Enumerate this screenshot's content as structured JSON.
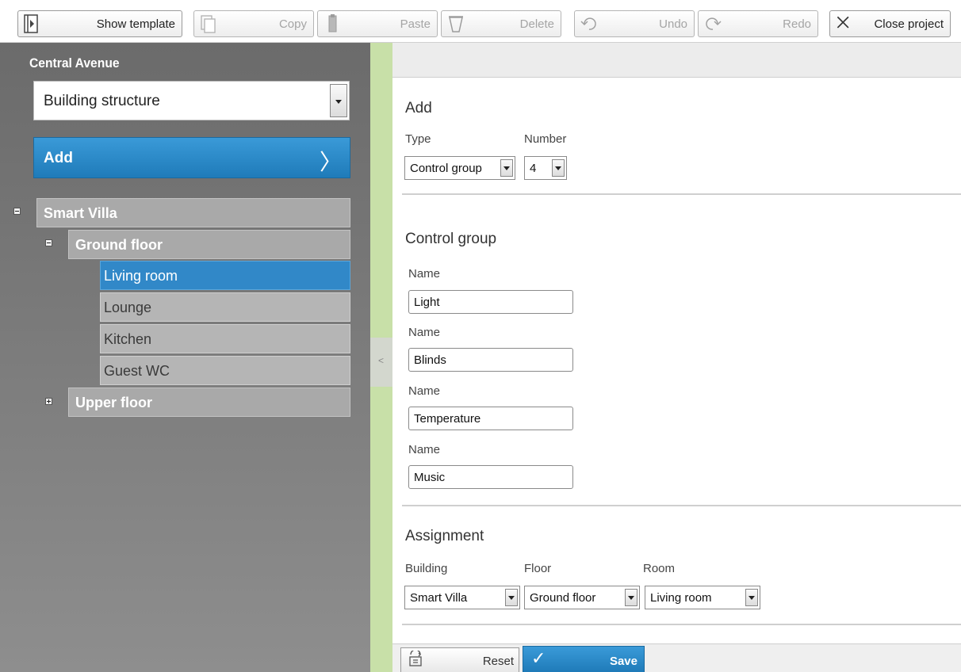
{
  "toolbar": {
    "show_template": "Show template",
    "copy": "Copy",
    "paste": "Paste",
    "delete": "Delete",
    "undo": "Undo",
    "redo": "Redo",
    "close_project": "Close project"
  },
  "left": {
    "project_name": "Central Avenue",
    "view_select": "Building structure",
    "add_button": "Add",
    "tree": {
      "building": "Smart Villa",
      "ground_floor": "Ground floor",
      "rooms": [
        "Living room",
        "Lounge",
        "Kitchen",
        "Guest WC"
      ],
      "upper_floor": "Upper floor"
    }
  },
  "right": {
    "add_section": {
      "title": "Add",
      "type_label": "Type",
      "type_value": "Control group",
      "number_label": "Number",
      "number_value": "4"
    },
    "control_group": {
      "title": "Control group",
      "name_label": "Name",
      "names": [
        "Light",
        "Blinds",
        "Temperature",
        "Music"
      ]
    },
    "assignment": {
      "title": "Assignment",
      "building_label": "Building",
      "building_value": "Smart Villa",
      "floor_label": "Floor",
      "floor_value": "Ground floor",
      "room_label": "Room",
      "room_value": "Living room"
    },
    "reset_button": "Reset",
    "save_button": "Save"
  },
  "colors": {
    "accent": "#2a88c8",
    "splitter": "#c8e0a8",
    "panel": "#7a7a7a"
  }
}
